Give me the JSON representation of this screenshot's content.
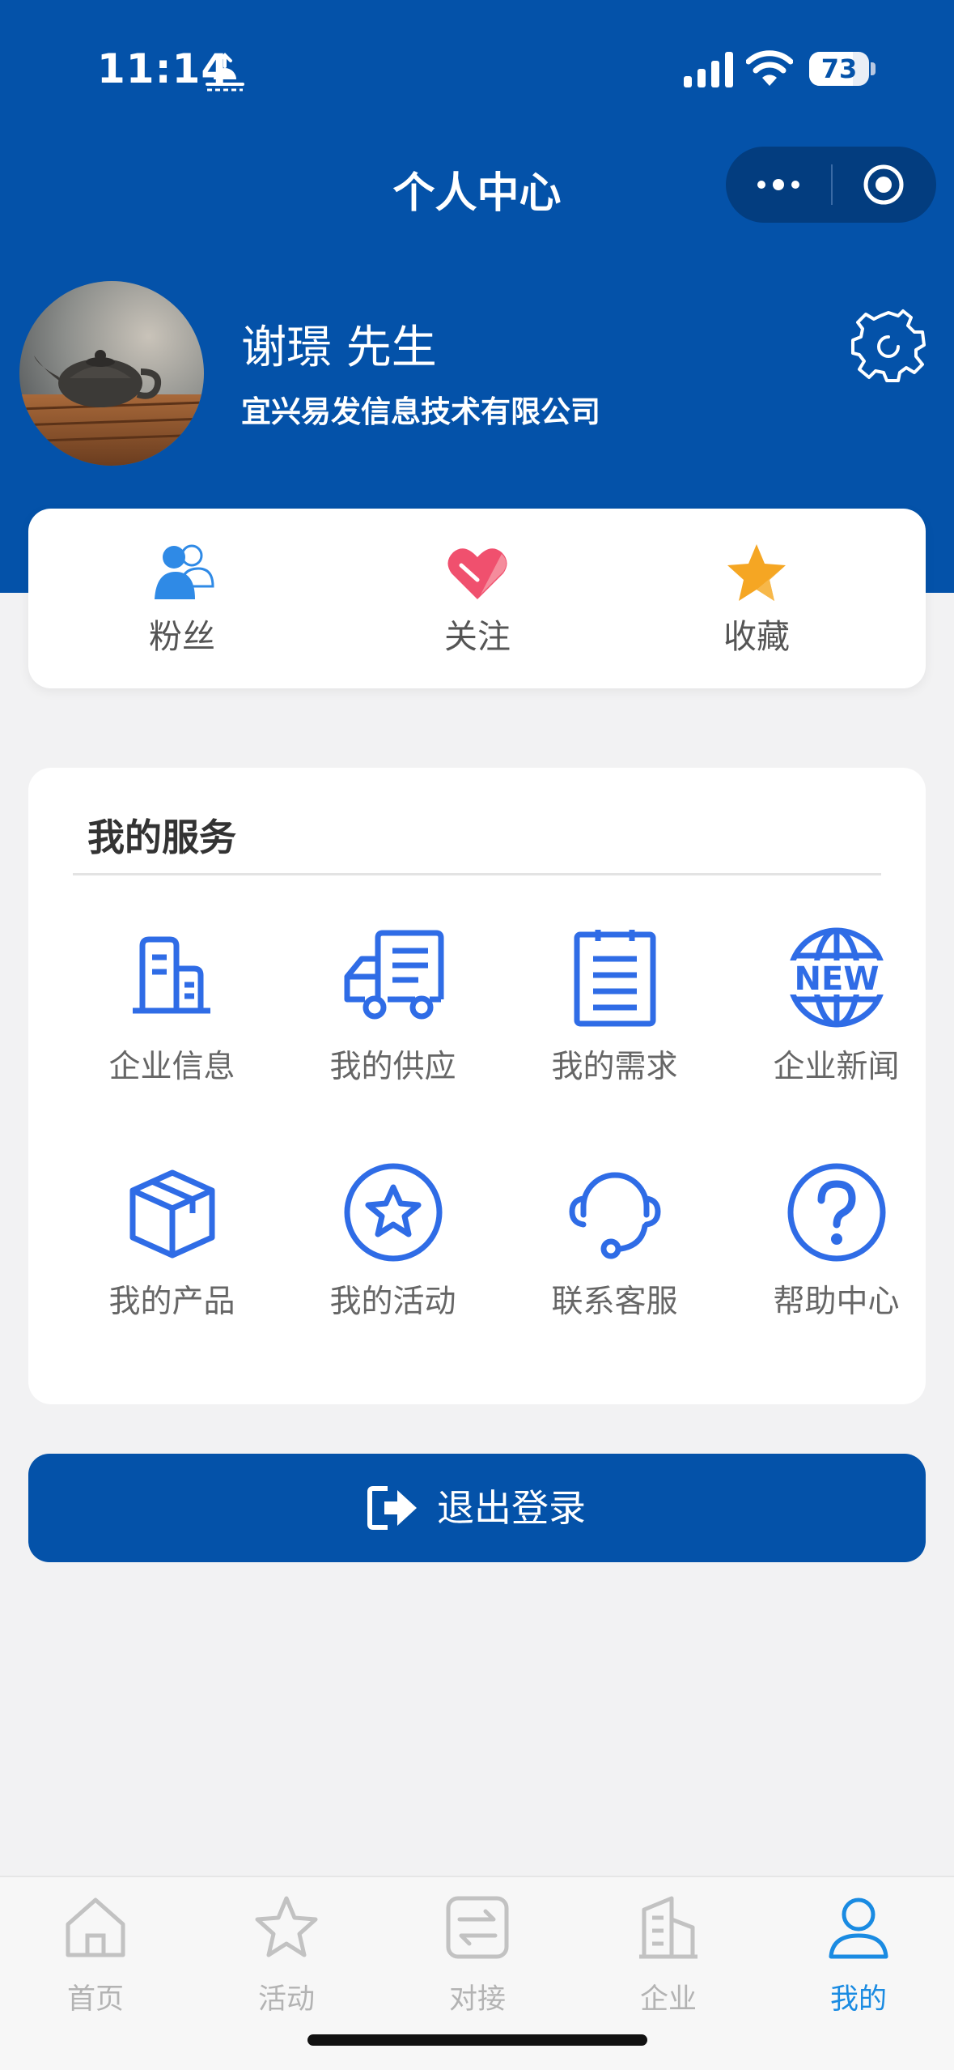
{
  "status_bar": {
    "time": "11:14",
    "battery": "73",
    "battery_level": 0.73
  },
  "nav": {
    "title": "个人中心"
  },
  "profile": {
    "name": "谢璟 先生",
    "company": "宜兴易发信息技术有限公司"
  },
  "stats": [
    {
      "label": "粉丝",
      "icon": "fans-icon"
    },
    {
      "label": "关注",
      "icon": "heart-icon"
    },
    {
      "label": "收藏",
      "icon": "star-icon"
    }
  ],
  "services": {
    "title": "我的服务",
    "items": [
      {
        "label": "企业信息",
        "icon": "building-icon"
      },
      {
        "label": "我的供应",
        "icon": "truck-icon"
      },
      {
        "label": "我的需求",
        "icon": "clipboard-icon"
      },
      {
        "label": "企业新闻",
        "icon": "news-globe-icon"
      },
      {
        "label": "我的产品",
        "icon": "box-icon"
      },
      {
        "label": "我的活动",
        "icon": "star-circle-icon"
      },
      {
        "label": "联系客服",
        "icon": "headset-icon"
      },
      {
        "label": "帮助中心",
        "icon": "help-icon"
      }
    ]
  },
  "logout": {
    "label": "退出登录"
  },
  "tabs": [
    {
      "label": "首页",
      "icon": "home-icon"
    },
    {
      "label": "活动",
      "icon": "star-outline-icon"
    },
    {
      "label": "对接",
      "icon": "exchange-icon"
    },
    {
      "label": "企业",
      "icon": "enterprise-icon"
    },
    {
      "label": "我的",
      "icon": "user-icon",
      "active": true
    }
  ],
  "colors": {
    "primary": "#0452a9",
    "icon_blue": "#2f6ce6",
    "tab_active": "#1a8be2",
    "heart": "#f0506e",
    "star": "#f5a623"
  }
}
